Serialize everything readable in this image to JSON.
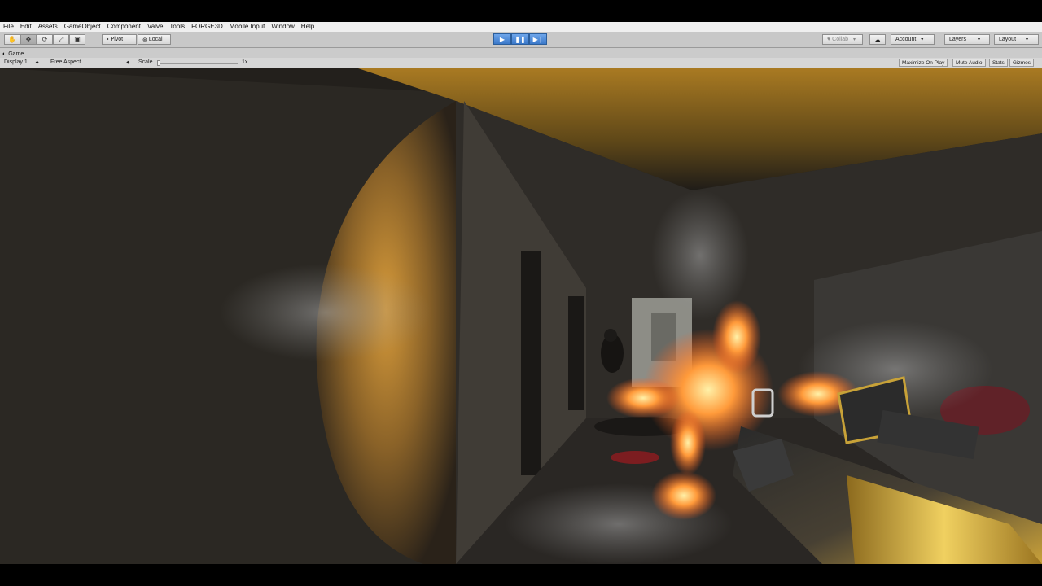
{
  "menu": [
    "File",
    "Edit",
    "Assets",
    "GameObject",
    "Component",
    "Valve",
    "Tools",
    "FORGE3D",
    "Mobile Input",
    "Window",
    "Help"
  ],
  "toolbar": {
    "transform_tools": [
      "hand-icon",
      "move-icon",
      "rotate-icon",
      "scale-icon",
      "rect-icon"
    ],
    "pivot_label": "Pivot",
    "local_label": "Local",
    "collab_label": "Collab",
    "account_label": "Account",
    "layers_label": "Layers",
    "layout_label": "Layout"
  },
  "game_tab": {
    "title": "Game",
    "display_label": "Display 1",
    "aspect_label": "Free Aspect",
    "scale_label": "Scale",
    "scale_value": "1x",
    "maximize_label": "Maximize On Play",
    "mute_label": "Mute Audio",
    "stats_label": "Stats",
    "gizmos_label": "Gizmos"
  },
  "colors": {
    "play_accent": "#3b78c9",
    "muzzle_flash": "#ff7a2a",
    "wall_highlight": "#c98a2a"
  }
}
